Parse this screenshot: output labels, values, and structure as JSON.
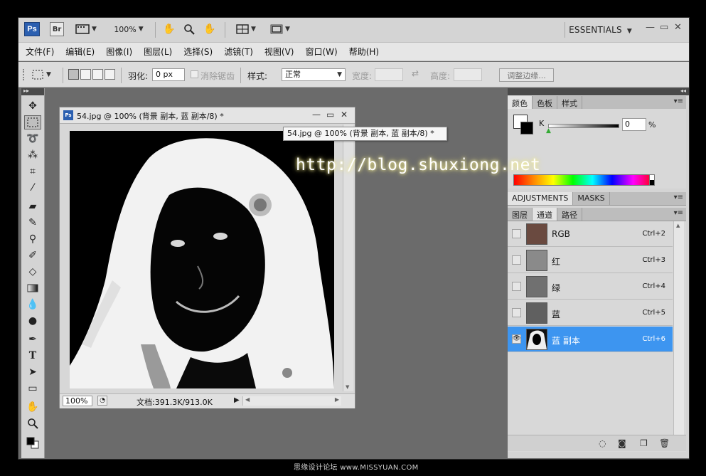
{
  "app": {
    "ps_logo": "Ps",
    "br_logo": "Br",
    "zoom": "100%",
    "workspace": "ESSENTIALS"
  },
  "menu": [
    "文件(F)",
    "编辑(E)",
    "图像(I)",
    "图层(L)",
    "选择(S)",
    "滤镜(T)",
    "视图(V)",
    "窗口(W)",
    "帮助(H)"
  ],
  "options": {
    "feather_label": "羽化:",
    "feather_value": "0 px",
    "antialias_label": "消除锯齿",
    "style_label": "样式:",
    "style_value": "正常",
    "width_label": "宽度:",
    "height_label": "高度:",
    "refine_edge": "调整边缘..."
  },
  "document": {
    "title": "54.jpg @ 100% (背景 副本, 蓝 副本/8) *",
    "zoom": "100%",
    "size_info": "文档:391.3K/913.0K"
  },
  "tooltip": "54.jpg @ 100% (背景 副本, 蓝 副本/8) *",
  "watermark": "http://blog.shuxiong.net",
  "color_panel": {
    "tabs": [
      "颜色",
      "色板",
      "样式"
    ],
    "channel_label": "K",
    "k_value": "0",
    "unit": "%"
  },
  "adjust_panel": {
    "tabs": [
      "ADJUSTMENTS",
      "MASKS"
    ]
  },
  "layers_panel": {
    "tabs": [
      "图层",
      "通道",
      "路径"
    ],
    "channels": [
      {
        "name": "RGB",
        "shortcut": "Ctrl+2"
      },
      {
        "name": "红",
        "shortcut": "Ctrl+3"
      },
      {
        "name": "绿",
        "shortcut": "Ctrl+4"
      },
      {
        "name": "蓝",
        "shortcut": "Ctrl+5"
      },
      {
        "name": "蓝 副本",
        "shortcut": "Ctrl+6"
      }
    ]
  },
  "footer_caption": "思缘设计论坛 www.MISSYUAN.COM",
  "colors": {
    "selected_row": "#3d95f0",
    "ps_blue": "#2b5fb0",
    "workspace_bg": "#6b6b6b"
  },
  "icons": {
    "move": "move-tool-icon",
    "marquee": "rect-marquee-icon",
    "lasso": "lasso-icon",
    "hand": "hand-icon",
    "zoom": "zoom-icon"
  }
}
